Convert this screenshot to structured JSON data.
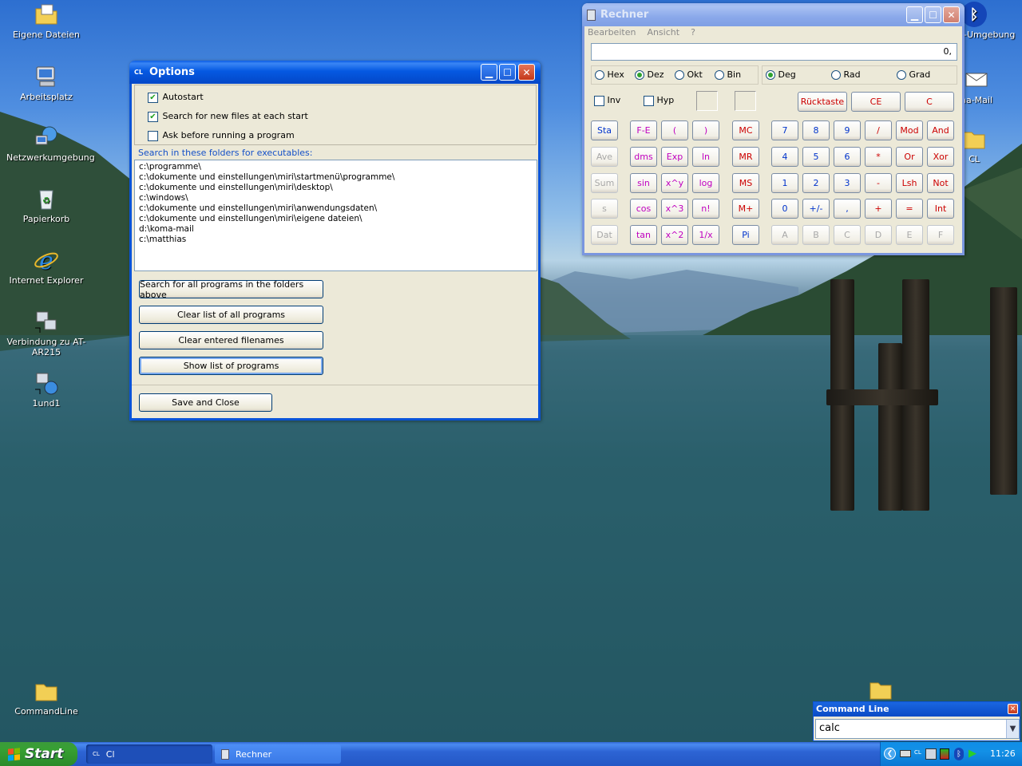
{
  "desktop": {
    "icons": [
      {
        "label": "Eigene Dateien",
        "icon": "folder-documents-icon"
      },
      {
        "label": "Arbeitsplatz",
        "icon": "computer-icon"
      },
      {
        "label": "Netzwerkumgebung",
        "icon": "network-icon"
      },
      {
        "label": "Papierkorb",
        "icon": "recycle-bin-icon"
      },
      {
        "label": "Internet Explorer",
        "icon": "internet-explorer-icon"
      },
      {
        "label": "Verbindung zu AT-AR215",
        "icon": "network-connection-icon"
      },
      {
        "label": "1und1",
        "icon": "network-connection-icon"
      },
      {
        "label": "CommandLine",
        "icon": "folder-icon"
      }
    ],
    "right_icons": [
      {
        "label": "n-Umgebung",
        "icon": "bluetooth-icon"
      },
      {
        "label": "na-Mail",
        "icon": "mail-icon"
      },
      {
        "label": "CL",
        "icon": "folder-icon"
      }
    ]
  },
  "options": {
    "title": "Options",
    "app_badge": "CL",
    "checkboxes": [
      {
        "label": "Autostart",
        "checked": true
      },
      {
        "label": "Search for new files at each start",
        "checked": true
      },
      {
        "label": "Ask before running a program",
        "checked": false
      }
    ],
    "folders_label": "Search in these folders for executables:",
    "folders": [
      "c:\\programme\\",
      "c:\\dokumente und einstellungen\\miri\\startmenü\\programme\\",
      "c:\\dokumente und einstellungen\\miri\\desktop\\",
      "c:\\windows\\",
      "c:\\dokumente und einstellungen\\miri\\anwendungsdaten\\",
      "c:\\dokumente und einstellungen\\miri\\eigene dateien\\",
      "d:\\koma-mail",
      "c:\\matthias"
    ],
    "buttons": {
      "search_all": "Search for all programs in the folders above",
      "clear_list": "Clear list of all programs",
      "clear_filenames": "Clear entered filenames",
      "show_list": "Show list of programs",
      "save_close": "Save and Close"
    }
  },
  "calculator": {
    "title": "Rechner",
    "menu": [
      "Bearbeiten",
      "Ansicht",
      "?"
    ],
    "display": "0,",
    "base_options": [
      {
        "label": "Hex",
        "selected": false
      },
      {
        "label": "Dez",
        "selected": true
      },
      {
        "label": "Okt",
        "selected": false
      },
      {
        "label": "Bin",
        "selected": false
      }
    ],
    "angle_options": [
      {
        "label": "Deg",
        "selected": true
      },
      {
        "label": "Rad",
        "selected": false
      },
      {
        "label": "Grad",
        "selected": false
      }
    ],
    "inv_label": "Inv",
    "hyp_label": "Hyp",
    "ruecktaste": "Rücktaste",
    "ce": "CE",
    "c": "C",
    "stat_buttons": [
      "Sta",
      "Ave",
      "Sum",
      "s",
      "Dat"
    ],
    "func_col1": [
      "F-E",
      "dms",
      "sin",
      "cos",
      "tan"
    ],
    "func_col2": [
      "(",
      "Exp",
      "x^y",
      "x^3",
      "x^2"
    ],
    "func_col3": [
      ")",
      "ln",
      "log",
      "n!",
      "1/x"
    ],
    "mem_buttons": [
      "MC",
      "MR",
      "MS",
      "M+",
      "Pi"
    ],
    "keypad": [
      [
        "7",
        "8",
        "9",
        "/",
        "Mod",
        "And"
      ],
      [
        "4",
        "5",
        "6",
        "*",
        "Or",
        "Xor"
      ],
      [
        "1",
        "2",
        "3",
        "-",
        "Lsh",
        "Not"
      ],
      [
        "0",
        "+/-",
        ",",
        "+",
        "=",
        "Int"
      ],
      [
        "A",
        "B",
        "C",
        "D",
        "E",
        "F"
      ]
    ]
  },
  "commandline": {
    "title": "Command Line",
    "input_value": "calc"
  },
  "taskbar": {
    "start_label": "Start",
    "tasks": [
      {
        "label": "Cl",
        "badge": "CL",
        "active": true
      },
      {
        "label": "Rechner",
        "badge": "",
        "active": false
      }
    ],
    "clock": "11:26"
  }
}
